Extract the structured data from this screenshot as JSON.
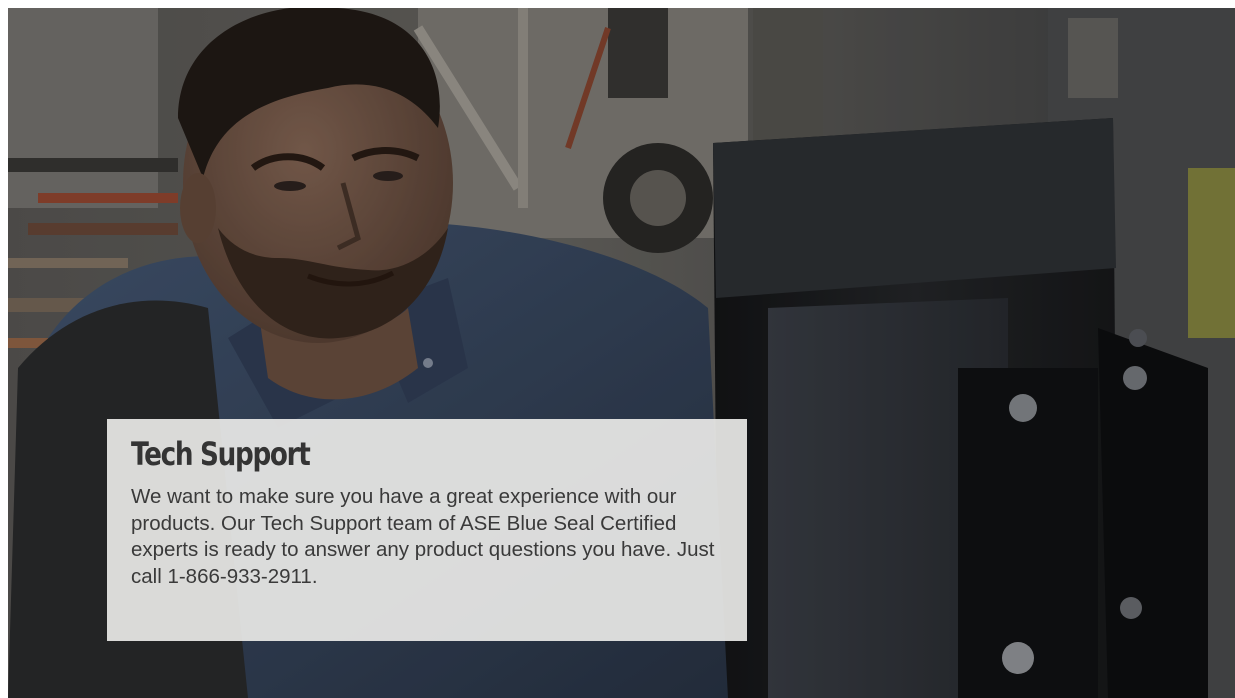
{
  "hero": {
    "photo": "technician-looking-at-diagnostic-monitor",
    "title": "Tech Support",
    "body": "We want to make sure you have a great experience with our products. Our Tech Support team of ASE Blue Seal Certified experts is ready to answer any product questions you have. Just call 1-866-933-2911."
  },
  "colors": {
    "card_background": "#e8e8e6",
    "title_text": "#343434",
    "body_text": "#3a3a3a",
    "shirt_blue": "#3d4f6a",
    "monitor_dark": "#1a1b1d"
  }
}
